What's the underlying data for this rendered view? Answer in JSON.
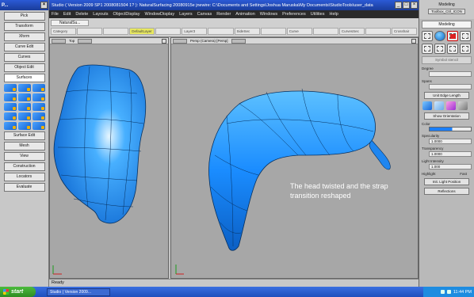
{
  "palette": {
    "title": "P...",
    "buttons": [
      "Pick",
      "Transform",
      "Xform",
      "Curve Edit",
      "Curves",
      "Object Edit",
      "Surfaces",
      "Surface Edit",
      "Mesh",
      "View",
      "Construction",
      "Locators",
      "Evaluate"
    ]
  },
  "main": {
    "title": "Studio ( Version 2009 SP1  2008081504 1? ): NaturalSurfacing  20080915e  jnewire: C:\\Documents and Settings\\Joshua Maruska\\My Documents\\StudioTools\\user_data",
    "menu": [
      "File",
      "Edit",
      "Delete",
      "Layouts",
      "ObjectDisplay",
      "WindowDisplay",
      "Layers",
      "Canvas",
      "Render",
      "Animation",
      "Windows",
      "Preferences",
      "Utilities",
      "Help"
    ],
    "shelf_tab": "NaturalSu...",
    "shelf_items": [
      "Category",
      "",
      "",
      "DefaultLayer",
      "",
      "Layer3",
      "",
      "SideSec",
      "",
      "Curve",
      "",
      "CurvesSec",
      "",
      "Crosshair"
    ],
    "viewport_left": "Top",
    "viewport_right": "Persp (Camera) [Persp]",
    "status": "Ready",
    "caption": "The head twisted and the strap transition reshaped"
  },
  "panel": {
    "mode_label": "Modeling",
    "mode_tag": "Toolbox_Ctrl_ICON",
    "tab": "Modeling",
    "field_top": "Symbol stencil",
    "degree_label": "Degree",
    "spans_label": "Spans",
    "unit_edge_button": "Unit Edge Length",
    "show_orientation": "Show Orientation",
    "color_label": "Color",
    "specularity_label": "Specularity",
    "specularity_value": "1.0000",
    "transparency_label": "Transparency",
    "transparency_value": "1.0000",
    "light_intensity_label": "Light Intensity",
    "light_intensity_value": "1.000",
    "highlight_label": "Highlight",
    "fast_label": "Fast",
    "lights_button": "Init. Light Position",
    "reflections_button": "Reflections"
  },
  "taskbar": {
    "start": "start",
    "task_item": "Studio ( Version 2009...",
    "clock": "11:44 PM"
  },
  "colors": {
    "surface": "#1a8cff",
    "title_bar": "#2b5ad6",
    "viewport_bg": "#a7a7a7"
  }
}
